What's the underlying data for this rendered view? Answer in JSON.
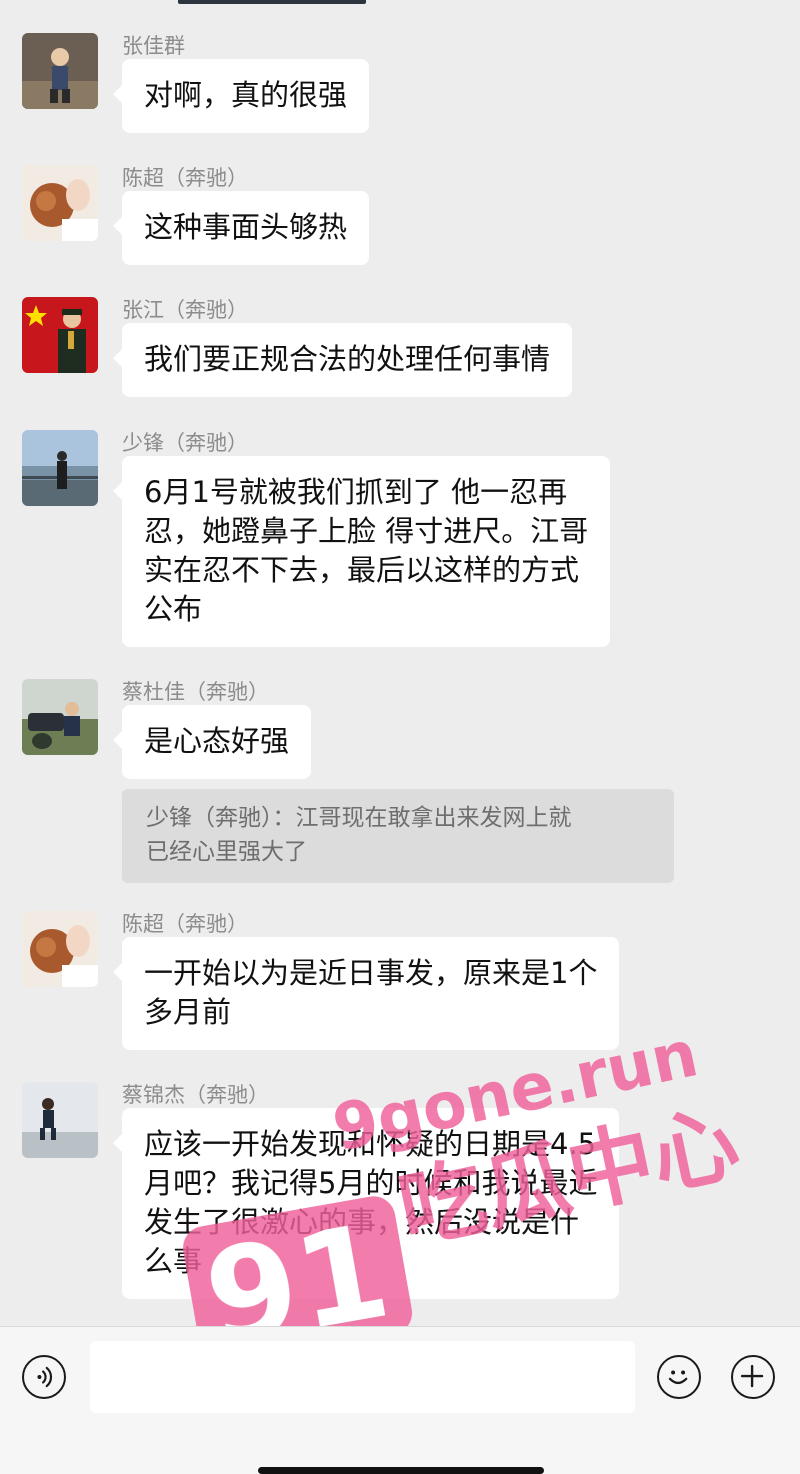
{
  "messages": [
    {
      "sender": "张佳群",
      "text": "对啊，真的很强"
    },
    {
      "sender": "陈超（奔驰）",
      "text": "这种事面头够热"
    },
    {
      "sender": "张江（奔驰）",
      "text": "我们要正规合法的处理任何事情"
    },
    {
      "sender": "少锋（奔驰）",
      "lines": [
        "6月1号就被我们抓到了  他一忍再",
        "忍，她蹬鼻子上脸  得寸进尺。江哥",
        "实在忍不下去，最后以这样的方式",
        "公布"
      ]
    },
    {
      "sender": "蔡杜佳（奔驰）",
      "text": "是心态好强"
    },
    {
      "sender": "陈超（奔驰）",
      "lines": [
        "一开始以为是近日事发，原来是1个",
        "多月前"
      ]
    },
    {
      "sender": "蔡锦杰（奔驰）",
      "lines": [
        "应该一开始发现和怀疑的日期是4.5",
        "月吧？我记得5月的时候和我说最近",
        "发生了很激心的事，然后没说是什",
        "么事"
      ]
    }
  ],
  "quote": {
    "lines": [
      "少锋（奔驰）：江哥现在敢拿出来发网上就",
      "已经心里强大了"
    ]
  },
  "watermark": {
    "number": "91",
    "site": "9gone.run",
    "label": "吃瓜中心",
    "color": "#f0609a"
  },
  "input_bar": {
    "voice_icon": "voice-icon",
    "emoji_icon": "emoji-icon",
    "plus_icon": "plus-icon",
    "placeholder": ""
  }
}
